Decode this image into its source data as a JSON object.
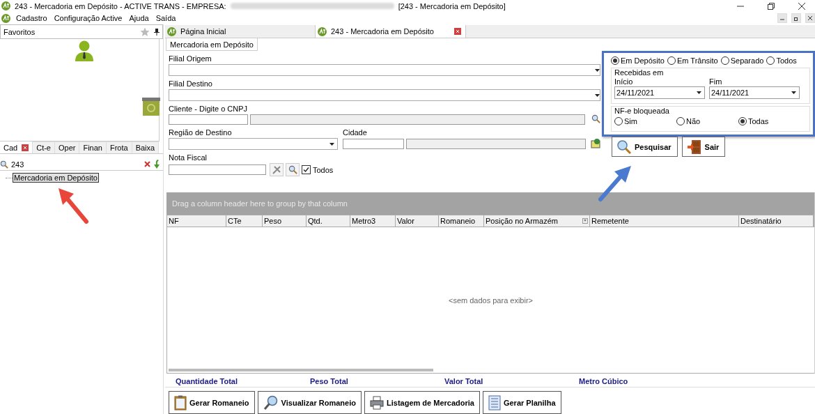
{
  "window": {
    "title_prefix": "243 - Mercadoria em Depósito - ACTIVE TRANS - EMPRESA:",
    "title_suffix": "[243 - Mercadoria em Depósito]"
  },
  "menu": [
    "Cadastro",
    "Configuração Active",
    "Ajuda",
    "Saída"
  ],
  "sidebar": {
    "favorites_label": "Favoritos",
    "tabs": [
      {
        "label": "Cad",
        "selected": true
      },
      {
        "label": "Ct-e",
        "selected": false
      },
      {
        "label": "Oper",
        "selected": false
      },
      {
        "label": "Finan",
        "selected": false
      },
      {
        "label": "Frota",
        "selected": false
      },
      {
        "label": "Baixa",
        "selected": false
      }
    ],
    "search": {
      "value": "243"
    },
    "tree": [
      {
        "label": "Mercadoria em Depósito",
        "selected": true
      }
    ]
  },
  "doc_tabs": [
    {
      "label": "Página Inicial",
      "selected": false
    },
    {
      "label": "243 - Mercadoria em Depósito",
      "selected": true
    }
  ],
  "sub_tab": {
    "label": "Mercadoria em Depósito"
  },
  "form": {
    "filial_origem": "Filial Origem",
    "filial_destino": "Filial Destino",
    "cliente": "Cliente - Digite o CNPJ",
    "regiao": "Região de Destino",
    "cidade": "Cidade",
    "nota_fiscal": "Nota Fiscal",
    "todos": {
      "label": "Todos",
      "checked": true
    }
  },
  "status_options": [
    {
      "label": "Em Depósito",
      "selected": true
    },
    {
      "label": "Em Trânsito",
      "selected": false
    },
    {
      "label": "Separado",
      "selected": false
    },
    {
      "label": "Todos",
      "selected": false
    }
  ],
  "received": {
    "legend": "Recebidas em",
    "start": {
      "label": "Início",
      "value": "24/11/2021"
    },
    "end": {
      "label": "Fim",
      "value": "24/11/2021"
    }
  },
  "nfe": {
    "legend": "NF-e bloqueada",
    "options": [
      {
        "label": "Sim",
        "selected": false
      },
      {
        "label": "Não",
        "selected": false
      },
      {
        "label": "Todas",
        "selected": true
      }
    ]
  },
  "actions": [
    {
      "kind": "search",
      "label": "Pesquisar"
    },
    {
      "kind": "exit",
      "label": "Sair"
    }
  ],
  "grid": {
    "group_hint": "Drag a column header here to group by that column",
    "columns": [
      "NF",
      "CTe",
      "Peso",
      "Qtd.",
      "Metro3",
      "Valor",
      "Romaneio",
      "Posição no Armazém",
      "Remetente",
      "Destinatário"
    ],
    "empty": "<sem dados para exibir>"
  },
  "totals": [
    "Quantidade Total",
    "Peso Total",
    "Valor Total",
    "Metro Cúbico"
  ],
  "bottom_buttons": [
    {
      "kind": "clipboard",
      "label": "Gerar Romaneio"
    },
    {
      "kind": "magnifier",
      "label": "Visualizar Romaneio"
    },
    {
      "kind": "printer",
      "label": "Listagem de Mercadoria"
    },
    {
      "kind": "sheet",
      "label": "Gerar Planilha"
    }
  ]
}
